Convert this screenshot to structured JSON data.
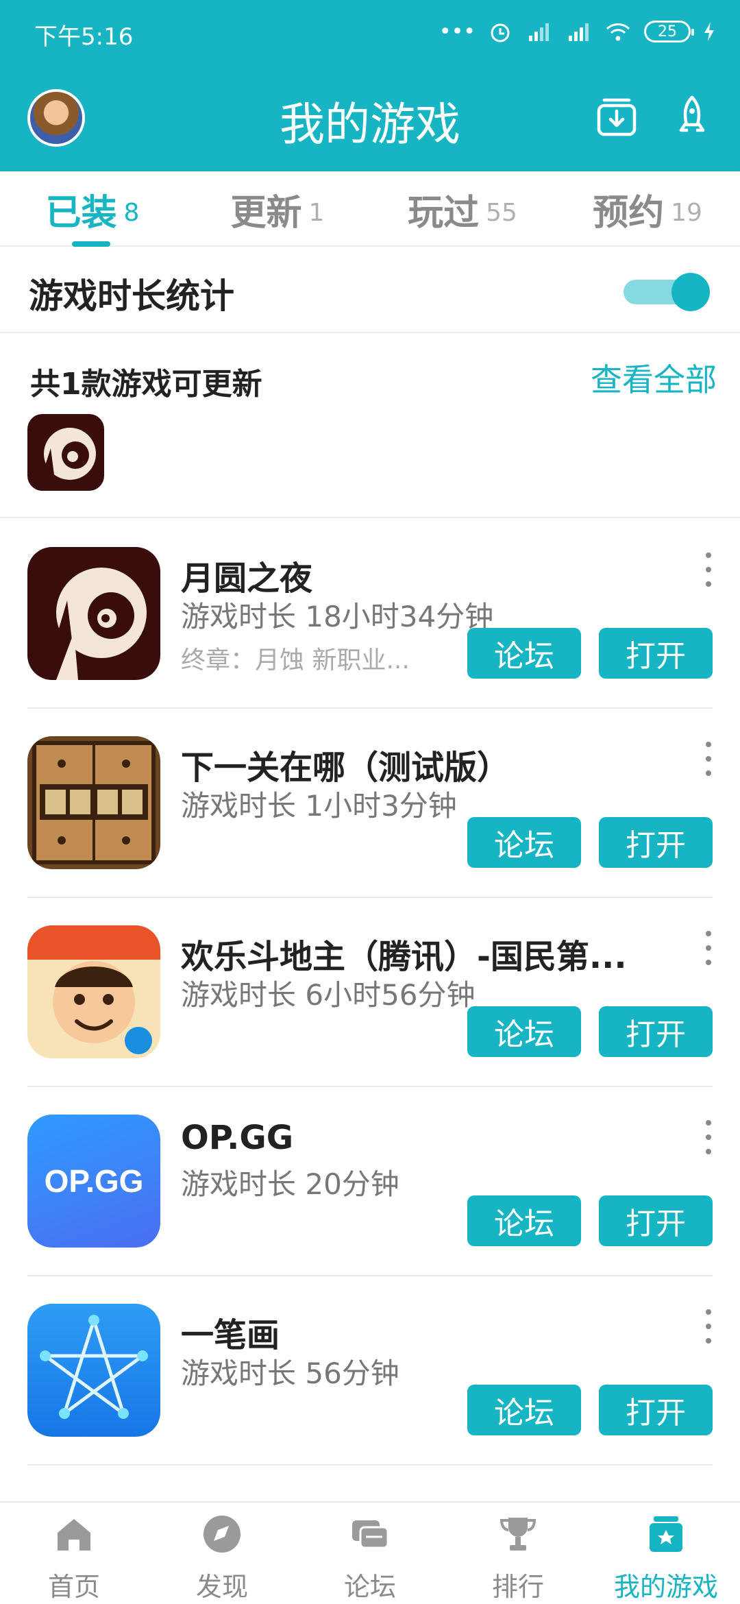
{
  "status_bar": {
    "time": "下午5:16",
    "battery": "25"
  },
  "header": {
    "title": "我的游戏"
  },
  "tabs": [
    {
      "label": "已装",
      "count": "8",
      "active": true
    },
    {
      "label": "更新",
      "count": "1",
      "active": false
    },
    {
      "label": "玩过",
      "count": "55",
      "active": false
    },
    {
      "label": "预约",
      "count": "19",
      "active": false
    }
  ],
  "stats": {
    "label": "游戏时长统计",
    "enabled": true
  },
  "updates": {
    "title": "共1款游戏可更新",
    "view_all": "查看全部"
  },
  "games": [
    {
      "name": "月圆之夜",
      "time": "游戏时长 18小时34分钟",
      "sub": "终章：月蚀 新职业...",
      "forum": "论坛",
      "open": "打开"
    },
    {
      "name": "下一关在哪（测试版）",
      "time": "游戏时长 1小时3分钟",
      "sub": "",
      "forum": "论坛",
      "open": "打开"
    },
    {
      "name": "欢乐斗地主（腾讯）-国民第...",
      "time": "游戏时长 6小时56分钟",
      "sub": "",
      "forum": "论坛",
      "open": "打开"
    },
    {
      "name": "OP.GG",
      "time": "游戏时长 20分钟",
      "sub": "",
      "forum": "论坛",
      "open": "打开",
      "icon_text": "OP.GG"
    },
    {
      "name": "一笔画",
      "time": "游戏时长 56分钟",
      "sub": "",
      "forum": "论坛",
      "open": "打开"
    }
  ],
  "bottom_nav": [
    {
      "label": "首页"
    },
    {
      "label": "发现"
    },
    {
      "label": "论坛"
    },
    {
      "label": "排行"
    },
    {
      "label": "我的游戏"
    }
  ],
  "colors": {
    "accent": "#17b5c4"
  }
}
